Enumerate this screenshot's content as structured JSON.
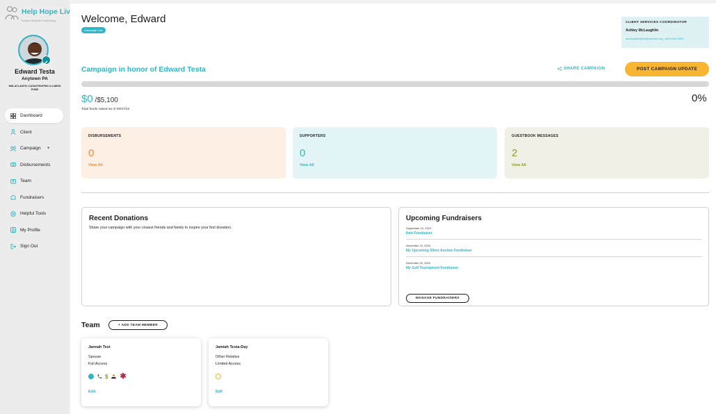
{
  "sidebar": {
    "logo_text": "Help Hope Live",
    "logo_tagline": "Trusted Medical Fundraising",
    "user_name": "Edward Testa",
    "user_location": "Anytown PA",
    "user_fund": "MID-ATLANTIC CATASTROPHIC ILLNESS FUND",
    "nav": [
      {
        "label": "Dashboard",
        "icon": "dashboard-grid-icon"
      },
      {
        "label": "Client",
        "icon": "person-icon"
      },
      {
        "label": "Campaign",
        "icon": "campaign-icon",
        "plus": "+"
      },
      {
        "label": "Disbursements",
        "icon": "money-icon"
      },
      {
        "label": "Team",
        "icon": "team-icon"
      },
      {
        "label": "Fundraisers",
        "icon": "fundraisers-icon"
      },
      {
        "label": "Helpful Tools",
        "icon": "help-icon"
      },
      {
        "label": "My Profile",
        "icon": "profile-icon"
      },
      {
        "label": "Sign Out",
        "icon": "sign-out-icon"
      }
    ]
  },
  "header": {
    "welcome": "Welcome, Edward",
    "badge": "Campaign Live"
  },
  "coordinator": {
    "title": "CLIENT SERVICES COORDINATOR",
    "name": "Ashley McLaughlin",
    "contact": "amclaughlin@helphopelive.org • (800) 642-8399"
  },
  "campaign": {
    "title": "Campaign in honor of Edward Testa",
    "share_label": "SHARE CAMPAIGN",
    "post_label": "POST CAMPAIGN UPDATE",
    "raised": "$0",
    "goal": " /$5,100",
    "raised_note": "Total funds raised as of 08/27/24",
    "percent": "0%",
    "progress": 0
  },
  "stats": [
    {
      "title": "DISBURSEMENTS",
      "value": "0",
      "link": "View All",
      "bg": "#fdefe4",
      "accent": "#f08a3c"
    },
    {
      "title": "SUPPORTERS",
      "value": "0",
      "link": "View All",
      "bg": "#e3f5f6",
      "accent": "#2fb6c7"
    },
    {
      "title": "GUESTBOOK MESSAGES",
      "value": "2",
      "link": "View All",
      "bg": "#f1f0e6",
      "accent": "#8f9a2f"
    }
  ],
  "recent": {
    "title": "Recent Donations",
    "subtitle": "Share your campaign with your closest friends and family to inspire your first donation."
  },
  "upcoming": {
    "title": "Upcoming Fundraisers",
    "items": [
      {
        "date": "September 10, 2024",
        "name": "New Fundraiser"
      },
      {
        "date": "November 13, 2024",
        "name": "My Upcoming Silent Auction Fundraiser"
      },
      {
        "date": "December 02, 2024",
        "name": "My Golf Tournament Fundraiser"
      }
    ],
    "manage_label": "MANAGE FUNDRAISERS"
  },
  "team": {
    "title": "Team",
    "add_label": "+ ADD TEAM MEMBER",
    "members": [
      {
        "name": "Jannah Test",
        "relation": "Spouse",
        "access": "Full Access",
        "edit": "Edit"
      },
      {
        "name": "Jamiah Testa-Day",
        "relation": "Other Relative",
        "access": "Limited Access",
        "edit": "Edit"
      }
    ]
  },
  "colors": {
    "accent": "#2fb6c7",
    "button_yellow": "#f7b531"
  }
}
